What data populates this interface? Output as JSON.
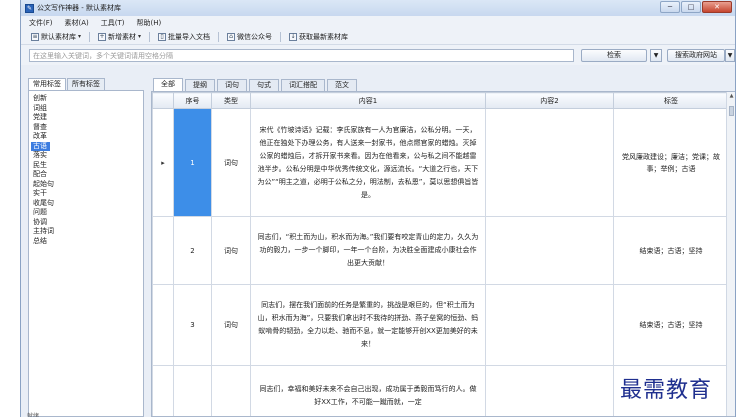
{
  "window": {
    "title": "公文写作神器 - 默认素材库",
    "controls": [
      "─",
      "□",
      "✕"
    ]
  },
  "menu": [
    "文件(F)",
    "素材(A)",
    "工具(T)",
    "帮助(H)"
  ],
  "toolbar": {
    "default_library": "默认素材库",
    "new_material": "新增素材",
    "batch_import": "批量导入文档",
    "wechat_account": "微信公众号",
    "get_latest": "获取最新素材库"
  },
  "search": {
    "placeholder": "在这里输入关键词，多个关键词请用空格分隔",
    "search_button": "检索",
    "gov_button": "搜索政府网站"
  },
  "left_tabs": [
    "常用标签",
    "所有标签"
  ],
  "tags": [
    "创新",
    "词组",
    "党建",
    "督查",
    "改革",
    "古语",
    "落实",
    "民生",
    "配合",
    "起始句",
    "实干",
    "收尾句",
    "问题",
    "协调",
    "主持词",
    "总结"
  ],
  "selected_tag_index": 5,
  "tabs": [
    "全部",
    "提纲",
    "词句",
    "句式",
    "词汇搭配",
    "范文"
  ],
  "columns": {
    "index": "序号",
    "type": "类型",
    "content1": "内容1",
    "content2": "内容2",
    "tag": "标签"
  },
  "rows": [
    {
      "index": "1",
      "type": "词句",
      "content1": "宋代《竹坡诗话》记载：李氏家族有一人为官廉洁，公私分明。一天，他正在独处下办理公务，有人送来一封家书，他点燃官家的蜡烛。灭掉公家的蜡烛后，才拆开家书来看。因为在他看来，公与私之间不能越雷池半步。公私分明是中华优秀传统文化，源远流长。“大道之行也，天下为公”“明主之道，必明于公私之分，明法制，去私恩”，莫以思想俱旨皆是。",
      "content2": "",
      "tag": "党风廉政建设；廉洁；党课；故事；举例；古语"
    },
    {
      "index": "2",
      "type": "词句",
      "content1": "同志们，“积土而为山，积水而为海。”我们要有咬定青山的定力，久久为功的毅力，一步一个脚印，一年一个台阶，为决胜全面建成小康社会作出更大贡献！",
      "content2": "",
      "tag": "结束语；古语；坚持"
    },
    {
      "index": "3",
      "type": "词句",
      "content1": "同志们，摆在我们面前的任务是繁重的，挑战是艰巨的，但“积土而为山，积水而为海”，只要我们拿出时不我待的拼劲、燕子垒窝的恒劲、蚂蚁啃骨的韧劲，全力以赴、驰而不息，就一定能够开创XX更加美好的未来！",
      "content2": "",
      "tag": "结束语；古语；坚持"
    },
    {
      "index": "",
      "type": "",
      "content1": "同志们，幸福和美好未来不会自己出现，成功属于勇毅而笃行的人。做好XX工作，不可能一蹴而就，一定",
      "content2": "",
      "tag": ""
    }
  ],
  "watermark": "最需教育",
  "status": "就绪"
}
